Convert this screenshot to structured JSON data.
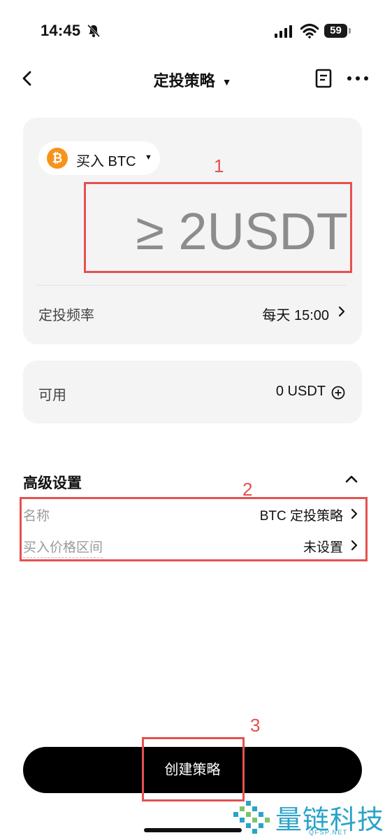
{
  "status_bar": {
    "time": "14:45",
    "battery": "59"
  },
  "nav": {
    "title": "定投策略",
    "title_caret": "▼"
  },
  "buy_card": {
    "btc_logo": "₿",
    "asset_label": "买入 BTC",
    "asset_caret": "▼",
    "amount_placeholder": "≥ 2USDT",
    "frequency_label": "定投频率",
    "frequency_value": "每天 15:00"
  },
  "available": {
    "label": "可用",
    "value": "0 USDT"
  },
  "advanced": {
    "title": "高级设置",
    "rows": [
      {
        "label": "名称",
        "value": "BTC 定投策略"
      },
      {
        "label": "买入价格区间",
        "value": "未设置"
      }
    ]
  },
  "create_button": "创建策略",
  "annotations": [
    "1",
    "2",
    "3"
  ],
  "watermark": {
    "text": "量链科技",
    "sub": "QFSP.NET"
  },
  "colors": {
    "annotation": "#e5514f",
    "btc": "#f7931a",
    "card_bg": "#f4f4f4",
    "watermark": "#2aa3c9"
  }
}
